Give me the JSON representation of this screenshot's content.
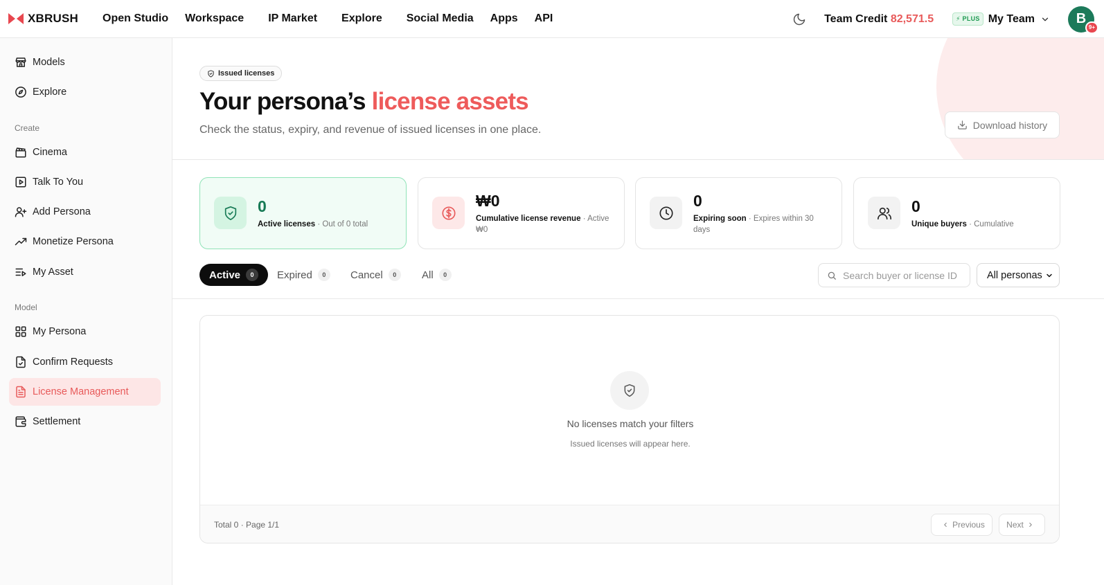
{
  "brand": {
    "name": "XBRUSH",
    "accent": "#e8474f"
  },
  "nav": [
    "Open Studio",
    "Workspace",
    "IP Market",
    "Explore",
    "Social Media",
    "Apps",
    "API"
  ],
  "topbar": {
    "credit_label": "Team Credit",
    "credit_value": "82,571.5",
    "plan_badge": "PLUS",
    "team_name": "My Team",
    "avatar_initial": "B",
    "notif": "9+"
  },
  "sidebar": {
    "top_items": [
      {
        "label": "Models",
        "icon": "store-icon"
      },
      {
        "label": "Explore",
        "icon": "compass-icon"
      }
    ],
    "section_create": "Create",
    "create_items": [
      {
        "label": "Cinema",
        "icon": "clapperboard-icon"
      },
      {
        "label": "Talk To You",
        "icon": "play-square-icon"
      },
      {
        "label": "Add Persona",
        "icon": "user-plus-icon"
      },
      {
        "label": "Monetize Persona",
        "icon": "trending-up-icon"
      },
      {
        "label": "My Asset",
        "icon": "list-video-icon"
      }
    ],
    "section_model": "Model",
    "model_items": [
      {
        "label": "My Persona",
        "icon": "grid-icon"
      },
      {
        "label": "Confirm Requests",
        "icon": "file-check-icon"
      },
      {
        "label": "License Management",
        "icon": "file-text-icon",
        "active": true
      },
      {
        "label": "Settlement",
        "icon": "wallet-icon"
      }
    ]
  },
  "header": {
    "chip": "Issued licenses",
    "title_main": "Your persona’s",
    "title_accent": "license assets",
    "subtitle": "Check the status, expiry, and revenue of issued licenses in one place.",
    "download_label": "Download history"
  },
  "stats": [
    {
      "value": "0",
      "label": "Active licenses",
      "note": "· Out of 0 total",
      "color": "#177a55",
      "icon": "shield-check-icon"
    },
    {
      "value": "₩0",
      "label": "Cumulative license revenue",
      "note": "· Active ₩0",
      "color": "#111111",
      "icon": "dollar-circle-icon"
    },
    {
      "value": "0",
      "label": "Expiring soon",
      "note": "· Expires within 30 days",
      "color": "#111111",
      "icon": "clock-icon"
    },
    {
      "value": "0",
      "label": "Unique buyers",
      "note": "· Cumulative",
      "color": "#111111",
      "icon": "users-icon"
    }
  ],
  "tabs": [
    {
      "label": "Active",
      "count": "0",
      "active": true
    },
    {
      "label": "Expired",
      "count": "0"
    },
    {
      "label": "Cancel",
      "count": "0"
    },
    {
      "label": "All",
      "count": "0"
    }
  ],
  "filters": {
    "search_placeholder": "Search buyer or license ID",
    "persona_select": "All personas"
  },
  "empty": {
    "title": "No licenses match your filters",
    "subtitle": "Issued licenses will appear here."
  },
  "pagination": {
    "info": "Total 0 · Page 1/1",
    "prev": "Previous",
    "next": "Next"
  }
}
